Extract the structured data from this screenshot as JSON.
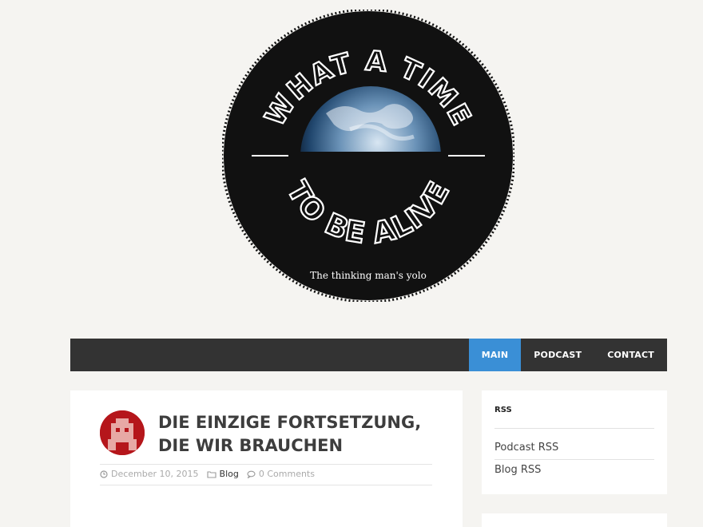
{
  "logo": {
    "top_text": "WHAT A TIME",
    "bottom_text": "TO BE ALIVE",
    "tagline": "The thinking man's yolo"
  },
  "nav": {
    "items": [
      {
        "label": "MAIN",
        "active": true
      },
      {
        "label": "PODCAST",
        "active": false
      },
      {
        "label": "CONTACT",
        "active": false
      }
    ]
  },
  "post": {
    "title": "DIE EINZIGE FORTSETZUNG, DIE WIR BRAUCHEN",
    "date": "December 10, 2015",
    "category": "Blog",
    "comments": "0 Comments"
  },
  "sidebar": {
    "rss_title": "RSS",
    "links": [
      "Podcast RSS",
      "Blog RSS"
    ]
  },
  "colors": {
    "nav_bg": "#333333",
    "nav_active": "#3a8fd6",
    "page_bg": "#f5f4f1",
    "avatar_red": "#b5161b"
  }
}
